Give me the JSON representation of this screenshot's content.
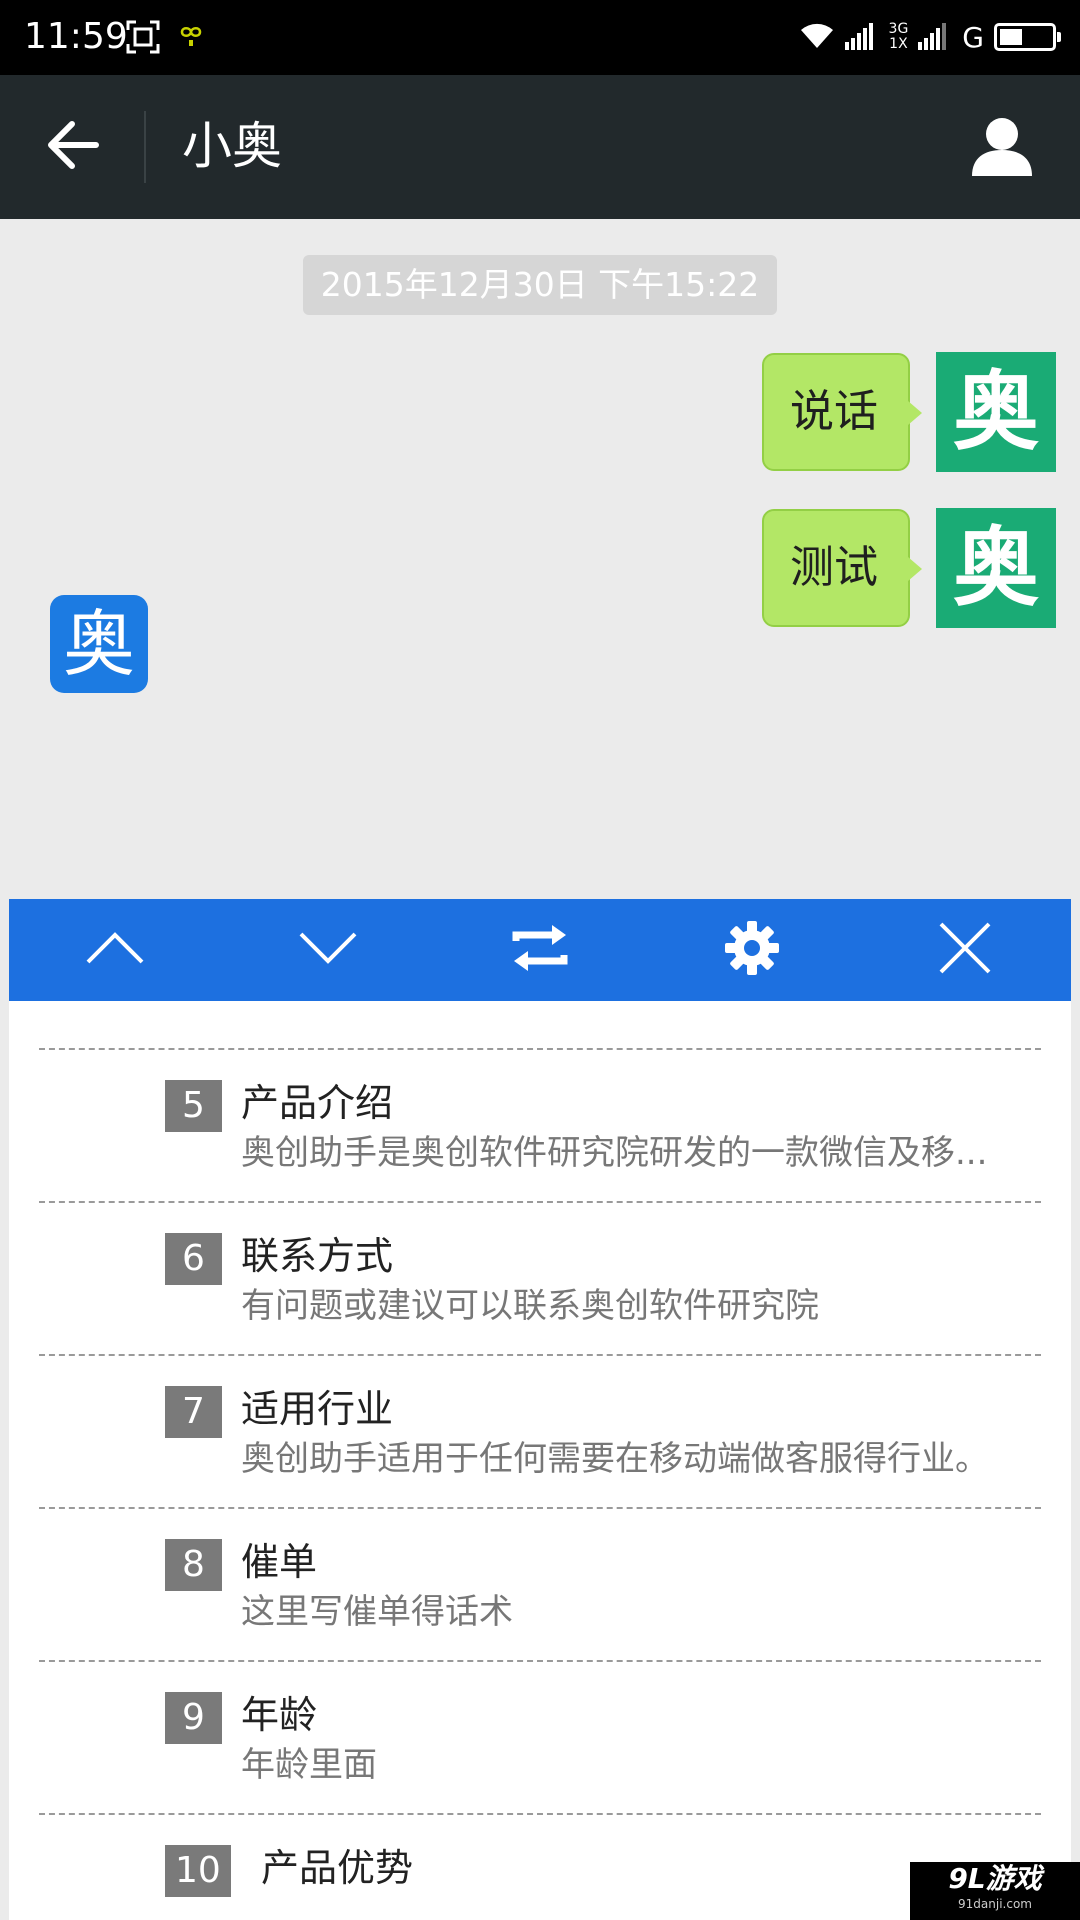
{
  "status_bar": {
    "time": "11:59",
    "network_top": "3G",
    "network_bottom": "1X",
    "carrier_letter": "G",
    "battery_level": 0.45
  },
  "header": {
    "title": "小奥",
    "back_icon": "arrow-left-icon",
    "profile_icon": "person-icon"
  },
  "chat": {
    "timestamp": "2015年12月30日 下午15:22",
    "messages": [
      {
        "text": "说话",
        "avatar": "奥"
      },
      {
        "text": "测试",
        "avatar": "奥"
      }
    ],
    "floating_button": "奥"
  },
  "toolbar": {
    "buttons": [
      "chevron-up-icon",
      "chevron-down-icon",
      "swap-icon",
      "gear-icon",
      "close-icon"
    ]
  },
  "quick_replies": [
    {
      "num": "5",
      "title": "产品介绍",
      "desc": "奥创助手是奥创软件研究院研发的一款微信及移..."
    },
    {
      "num": "6",
      "title": "联系方式",
      "desc": "有问题或建议可以联系奥创软件研究院"
    },
    {
      "num": "7",
      "title": "适用行业",
      "desc": "奥创助手适用于任何需要在移动端做客服得行业。"
    },
    {
      "num": "8",
      "title": "催单",
      "desc": "这里写催单得话术"
    },
    {
      "num": "9",
      "title": "年龄",
      "desc": "年龄里面"
    },
    {
      "num": "10",
      "title": "产品优势",
      "desc": ""
    }
  ],
  "watermark": {
    "main": "9L游戏",
    "sub": "91danji.com"
  },
  "colors": {
    "status_bar": "#000000",
    "app_bar": "#22292c",
    "chat_background": "#ebebeb",
    "bubble": "#b3e766",
    "avatar_green": "#1aab75",
    "accent_blue": "#1d70e0"
  }
}
